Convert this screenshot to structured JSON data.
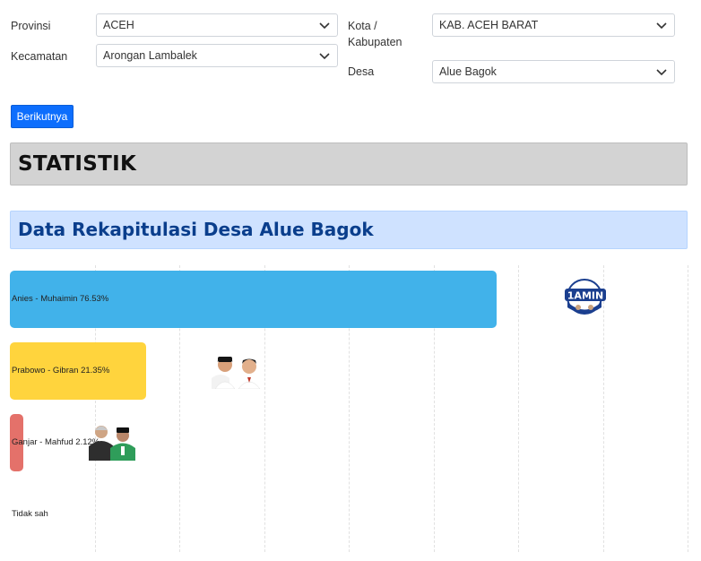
{
  "form": {
    "provinsi": {
      "label": "Provinsi",
      "value": "ACEH"
    },
    "kota": {
      "label_line1": "Kota /",
      "label_line2": "Kabupaten",
      "value": "KAB. ACEH BARAT"
    },
    "kecamatan": {
      "label": "Kecamatan",
      "value": "Arongan Lambalek"
    },
    "desa": {
      "label": "Desa",
      "value": "Alue Bagok"
    },
    "next_button": "Berikutnya"
  },
  "sections": {
    "statistik_title": "STATISTIK",
    "rekap_title": "Data Rekapitulasi Desa Alue Bagok"
  },
  "colors": {
    "bar_anies": "#41b2ea",
    "bar_prabowo": "#ffd43d",
    "bar_ganjar": "#e4716a",
    "button": "#0d6efd",
    "rekap_banner": "#cfe2ff",
    "rekap_text": "#0a3e8c"
  },
  "chart_data": {
    "type": "bar",
    "orientation": "horizontal",
    "categories": [
      "Anies - Muhaimin",
      "Prabowo - Gibran",
      "Ganjar - Mahfud",
      "Tidak sah"
    ],
    "values": [
      76.53,
      21.35,
      2.12,
      0
    ],
    "labels": [
      "Anies - Muhaimin 76.53%",
      "Prabowo - Gibran 21.35%",
      "Ganjar - Mahfud 2.12%",
      "Tidak sah"
    ],
    "title": "",
    "xlabel": "",
    "ylabel": "",
    "xlim": [
      0,
      100
    ],
    "grid": true,
    "icons": [
      "amin-logo-icon",
      "prabowo-gibran-photo-icon",
      "ganjar-mahfud-photo-icon"
    ]
  }
}
